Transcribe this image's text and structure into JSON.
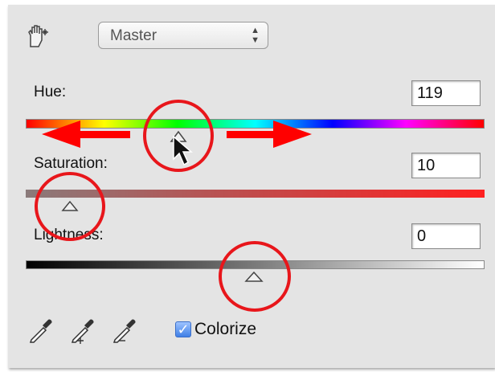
{
  "header": {
    "preset_label": "Master",
    "preset_arrows": "▴▾"
  },
  "hue": {
    "label": "Hue:",
    "value": "119"
  },
  "saturation": {
    "label": "Saturation:",
    "value": "10"
  },
  "lightness": {
    "label": "Lightness:",
    "value": "0"
  },
  "footer": {
    "colorize_label": "Colorize",
    "colorize_checked": true,
    "check_mark": "✓"
  },
  "icons": {
    "hand_tool": "targeted-adjustment-hand-icon",
    "eyedropper": "eyedropper-icon",
    "eyedropper_add": "eyedropper-plus-icon",
    "eyedropper_subtract": "eyedropper-minus-icon"
  },
  "annotations": {
    "circle_color": "#e8161b",
    "arrow_color": "#ff0000"
  }
}
